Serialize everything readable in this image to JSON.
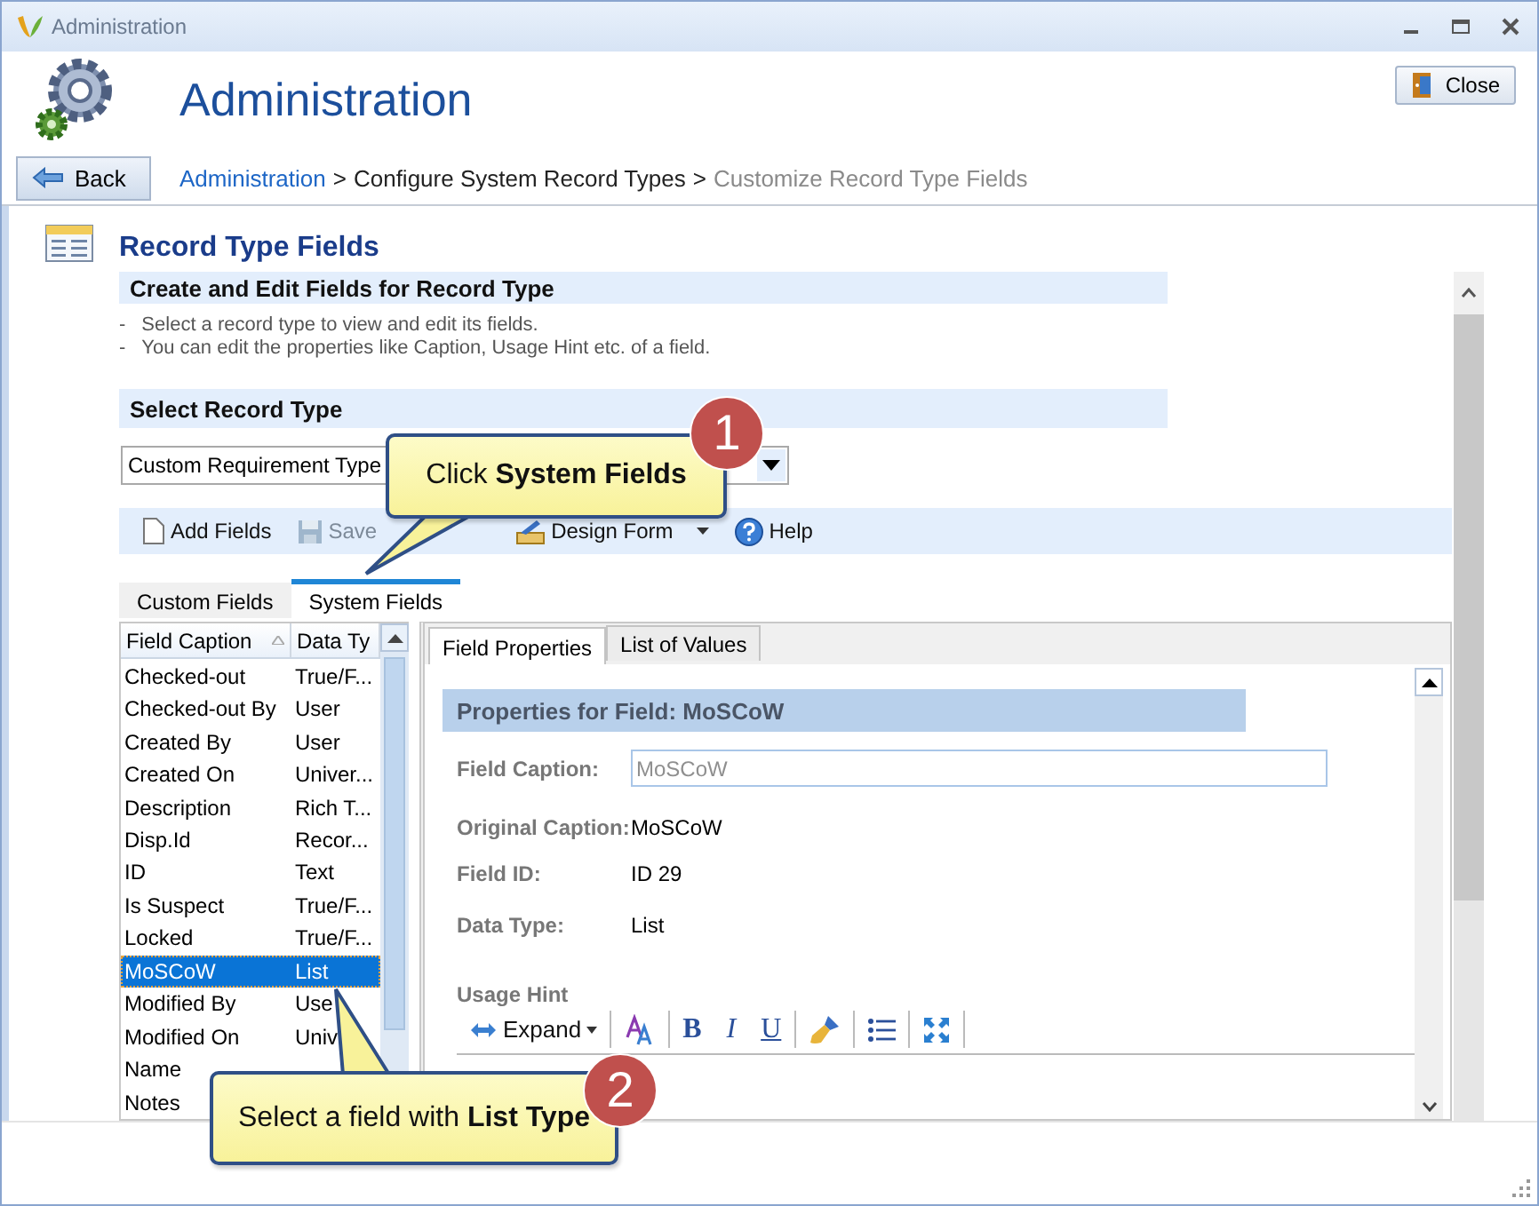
{
  "window": {
    "title": "Administration"
  },
  "header": {
    "title": "Administration",
    "close_button": "Close",
    "back_button": "Back",
    "breadcrumb": [
      {
        "label": "Administration",
        "kind": "link"
      },
      {
        "label": ">",
        "kind": "separator"
      },
      {
        "label": "Configure System Record Types",
        "kind": "plain"
      },
      {
        "label": ">",
        "kind": "separator"
      },
      {
        "label": "Customize Record Type Fields",
        "kind": "current"
      }
    ]
  },
  "section": {
    "title": "Record Type Fields",
    "subtitle": "Create and Edit Fields for Record Type",
    "notes": [
      "Select a record type to view and edit its fields.",
      "You can edit the properties like Caption, Usage Hint etc. of a field."
    ],
    "bullet": "-",
    "select_heading": "Select Record Type",
    "record_type": "Custom Requirement Type"
  },
  "toolbar": [
    {
      "kind": "add",
      "label": "Add Fields",
      "disabled": false
    },
    {
      "kind": "save",
      "label": "Save",
      "disabled": true
    },
    {
      "kind": "design",
      "label": "Design Form",
      "disabled": false
    },
    {
      "kind": "help",
      "label": "Help",
      "disabled": false
    }
  ],
  "tabs": [
    {
      "label": "Custom Fields",
      "selected": false
    },
    {
      "label": "System Fields",
      "selected": true
    }
  ],
  "field_list": {
    "columns": [
      "Field Caption",
      "Data Ty"
    ],
    "rows": [
      {
        "caption": "Checked-out",
        "data_type": "True/F...",
        "selected": false
      },
      {
        "caption": "Checked-out By",
        "data_type": "User",
        "selected": false
      },
      {
        "caption": "Created By",
        "data_type": "User",
        "selected": false
      },
      {
        "caption": "Created On",
        "data_type": "Univer...",
        "selected": false
      },
      {
        "caption": "Description",
        "data_type": "Rich T...",
        "selected": false
      },
      {
        "caption": "Disp.Id",
        "data_type": "Recor...",
        "selected": false
      },
      {
        "caption": "ID",
        "data_type": "Text",
        "selected": false
      },
      {
        "caption": "Is Suspect",
        "data_type": "True/F...",
        "selected": false
      },
      {
        "caption": "Locked",
        "data_type": "True/F...",
        "selected": false
      },
      {
        "caption": "MoSCoW",
        "data_type": "List",
        "selected": true
      },
      {
        "caption": "Modified By",
        "data_type": "Use",
        "selected": false
      },
      {
        "caption": "Modified On",
        "data_type": "Univ",
        "selected": false
      },
      {
        "caption": "Name",
        "selected": false
      },
      {
        "caption": "Notes",
        "selected": false
      }
    ]
  },
  "detail_tabs": [
    {
      "label": "Field Properties",
      "selected": true
    },
    {
      "label": "List of Values",
      "selected": false
    }
  ],
  "properties": {
    "title": "Properties for Field: **MoSCoW**",
    "field_caption": {
      "label": "Field Caption:",
      "value": "MoSCoW",
      "disabled": true
    },
    "rows": [
      {
        "label": "Original Caption:",
        "value": "MoSCoW"
      },
      {
        "label": "Field ID:",
        "value": "ID 29"
      },
      {
        "label": "Data Type:",
        "value": "List"
      }
    ],
    "usage_hint": "Usage Hint",
    "editor_toolbar": [
      {
        "kind": "expand",
        "label": "Expand"
      },
      {
        "kind": "font-color"
      },
      {
        "kind": "bold",
        "label": "B"
      },
      {
        "kind": "italic",
        "label": "I"
      },
      {
        "kind": "underline",
        "label": "U"
      },
      {
        "kind": "brush"
      },
      {
        "kind": "list"
      },
      {
        "kind": "fullscreen"
      }
    ]
  },
  "callouts": [
    {
      "number": "1",
      "text": "Click **System Fields**"
    },
    {
      "number": "2",
      "text": "Select a field with **List Type**"
    }
  ]
}
